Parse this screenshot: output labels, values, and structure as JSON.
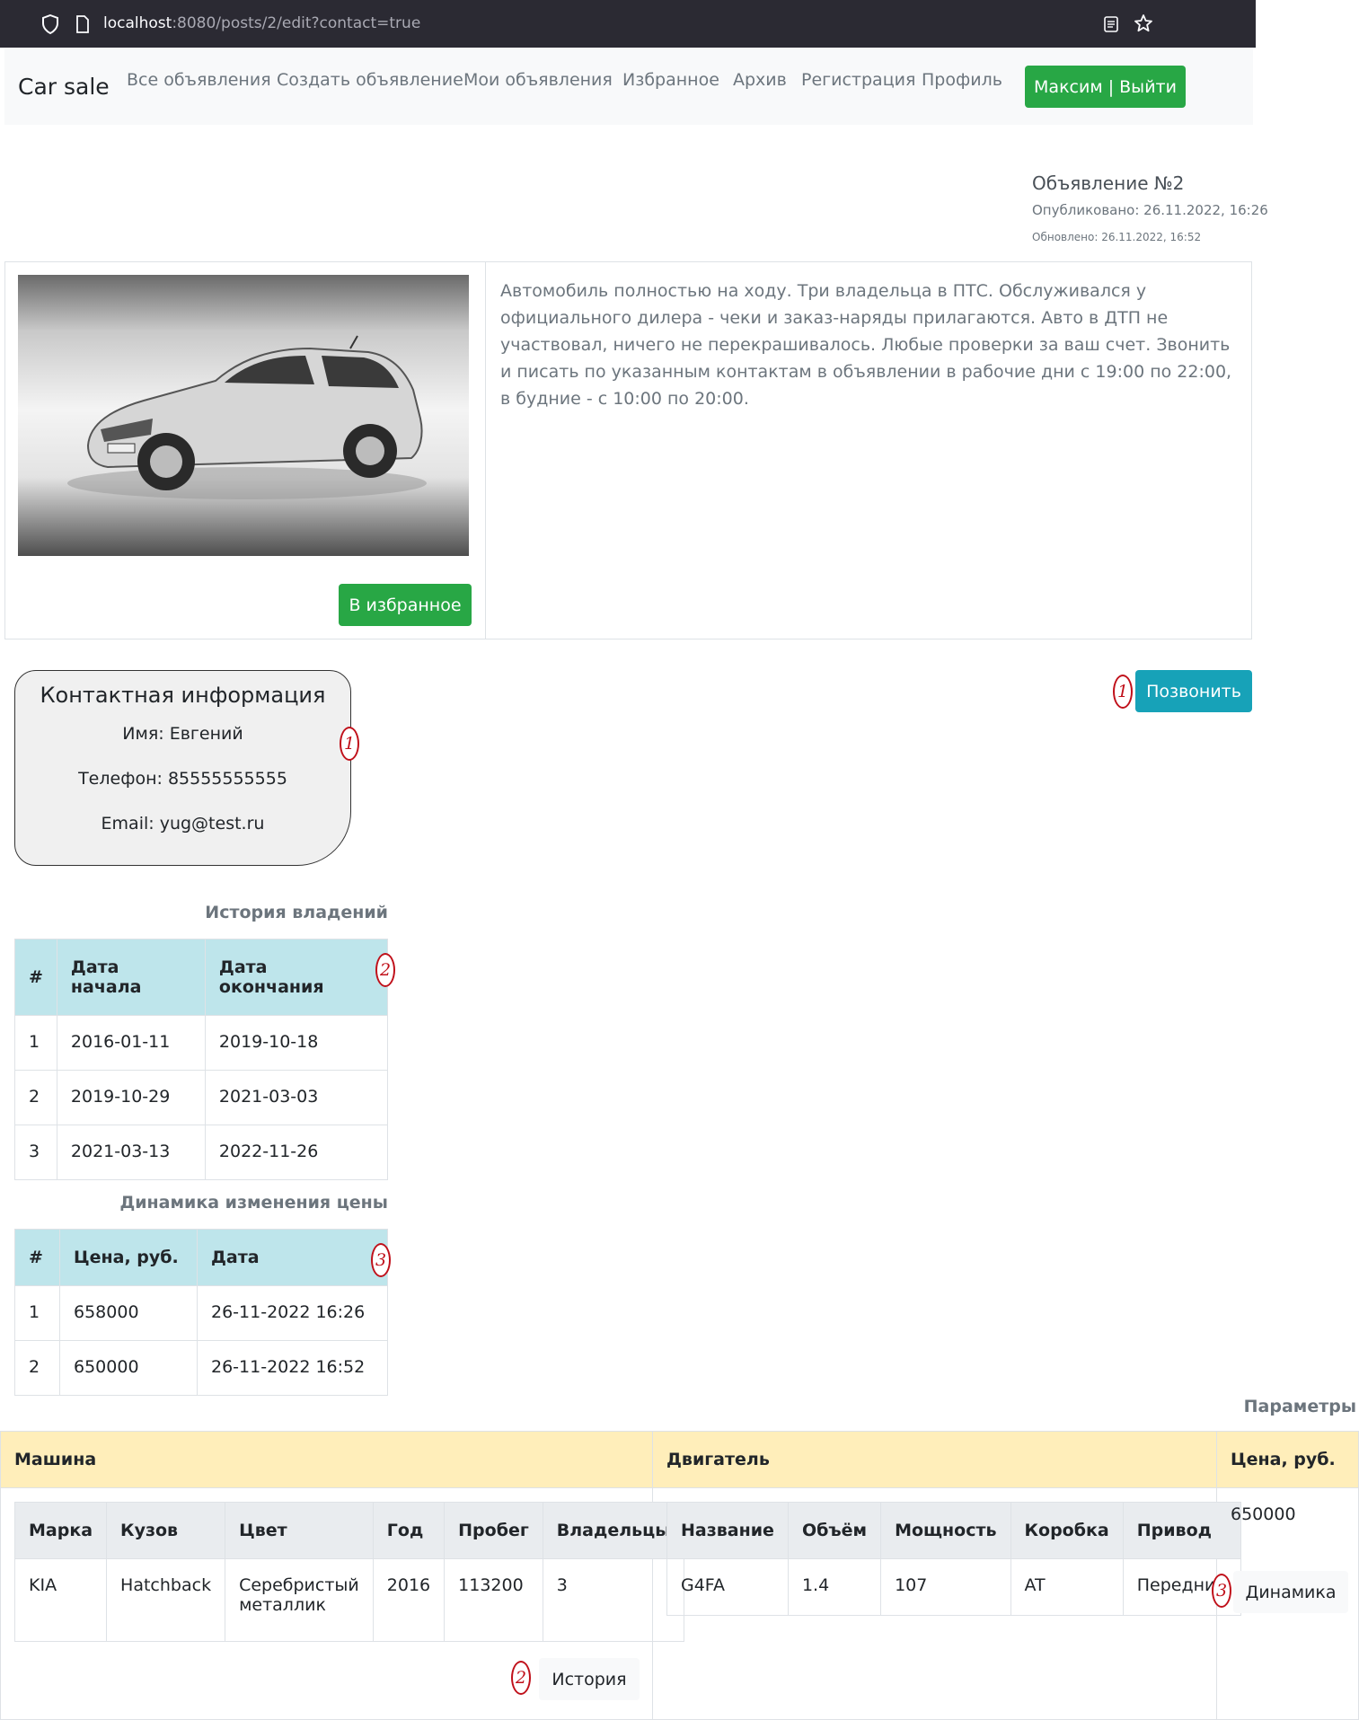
{
  "browser": {
    "url_host": "localhost",
    "url_rest": ":8080/posts/2/edit?contact=true"
  },
  "navbar": {
    "brand": "Car sale",
    "links": [
      "Все объявления",
      "Создать объявление",
      "Мои объявления",
      "Избранное",
      "Архив",
      "Регистрация",
      "Профиль"
    ],
    "logout_label": "Максим | Выйти"
  },
  "post": {
    "title": "Объявление №2",
    "published": "Опубликовано: 26.11.2022, 16:26",
    "updated": "Обновлено: 26.11.2022, 16:52",
    "description": "Автомобиль полностью на ходу. Три владельца в ПТС. Обслуживался у официального дилера - чеки и заказ-наряды прилагаются. Авто в ДТП не участвовал, ничего не перекрашивалось. Любые проверки за ваш счет. Звонить и писать по указанным контактам в объявлении в рабочие дни с 19:00 по 22:00, в будние - с 10:00 по 20:00.",
    "favorite_label": "В избранное",
    "call_label": "Позвонить"
  },
  "contact": {
    "title": "Контактная информация",
    "name": "Имя: Евгений",
    "phone": "Телефон: 85555555555",
    "email": "Email: yug@test.ru"
  },
  "markers": {
    "one": "1",
    "two": "2",
    "three": "3"
  },
  "ownership": {
    "caption": "История владений",
    "headers": [
      "#",
      "Дата начала",
      "Дата окончания"
    ],
    "rows": [
      [
        "1",
        "2016-01-11",
        "2019-10-18"
      ],
      [
        "2",
        "2019-10-29",
        "2021-03-03"
      ],
      [
        "3",
        "2021-03-13",
        "2022-11-26"
      ]
    ]
  },
  "price_history": {
    "caption": "Динамика изменения цены",
    "headers": [
      "#",
      "Цена, руб.",
      "Дата"
    ],
    "rows": [
      [
        "1",
        "658000",
        "26-11-2022 16:26"
      ],
      [
        "2",
        "650000",
        "26-11-2022 16:52"
      ]
    ]
  },
  "params": {
    "caption": "Параметры",
    "headers": [
      "Машина",
      "Двигатель",
      "Цена, руб."
    ],
    "car_headers": [
      "Марка",
      "Кузов",
      "Цвет",
      "Год",
      "Пробег",
      "Владельцы"
    ],
    "car_row": [
      "KIA",
      "Hatchback",
      "Серебристый металлик",
      "2016",
      "113200",
      "3"
    ],
    "engine_headers": [
      "Название",
      "Объём",
      "Мощность",
      "Коробка",
      "Привод"
    ],
    "engine_row": [
      "G4FA",
      "1.4",
      "107",
      "AT",
      "Передний"
    ],
    "price": "650000",
    "history_label": "История",
    "dynamics_label": "Динамика"
  },
  "colors": {
    "success": "#28a745",
    "info": "#17a2b8",
    "table_info": "#bee5eb",
    "table_warning": "#ffeeba",
    "marker": "#c0101a"
  }
}
